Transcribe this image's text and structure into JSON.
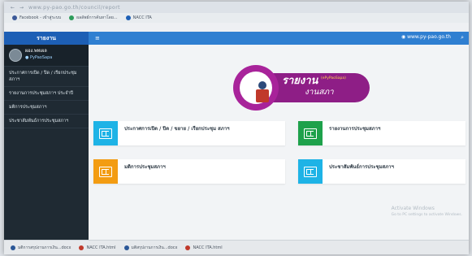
{
  "browser": {
    "url": "www.py-pao.go.th/council/report",
    "bookmarks": [
      {
        "label": "Facebook - เข้าสู่ระบบ",
        "color": "#3b5998"
      },
      {
        "label": "ผลลัพธ์การค้นหาโดย...",
        "color": "#2d9c5b"
      },
      {
        "label": "NACC ITA",
        "color": "#1d5fb5"
      }
    ]
  },
  "header": {
    "brand": "รายงาน",
    "site_link": "www.py-pao.go.th"
  },
  "sidebar": {
    "user_name": "ผอง.พทเผล",
    "user_role": "● PyPaoSapa",
    "items": [
      {
        "label": "ประกาศการเปิด / ปิด / เรียกประชุม สภาฯ"
      },
      {
        "label": "รายงานการประชุมสภาฯ ประจำปี"
      },
      {
        "label": "มติการประชุมสภาฯ"
      },
      {
        "label": "ประชาสัมพันธ์การประชุมสภาฯ"
      }
    ]
  },
  "banner": {
    "title": "รายงาน",
    "tag": "(ePyPaoSapa)",
    "subtitle": "งานสภา"
  },
  "cards": [
    {
      "label": "ประกาศการเปิด / ปิด / ขยาย / เรียกประชุม สภาฯ",
      "color": "#1eb3e6"
    },
    {
      "label": "รายงานการประชุมสภาฯ",
      "color": "#1ea14b"
    },
    {
      "label": "มติการประชุมสภาฯ",
      "color": "#f39c12"
    },
    {
      "label": "ประชาสัมพันธ์การประชุมสภาฯ",
      "color": "#1eb3e6"
    }
  ],
  "taskbar": [
    {
      "label": "มติการสรุปงานการเงิน...docx",
      "color": "#2b5797"
    },
    {
      "label": "NACC ITA.html",
      "color": "#c0392b"
    },
    {
      "label": "มติสรุปงานการเงิน...docx",
      "color": "#2b5797"
    },
    {
      "label": "NACC ITA.html",
      "color": "#c0392b"
    }
  ],
  "watermark": {
    "line1": "Activate Windows",
    "line2": "Go to PC settings to activate Windows."
  }
}
